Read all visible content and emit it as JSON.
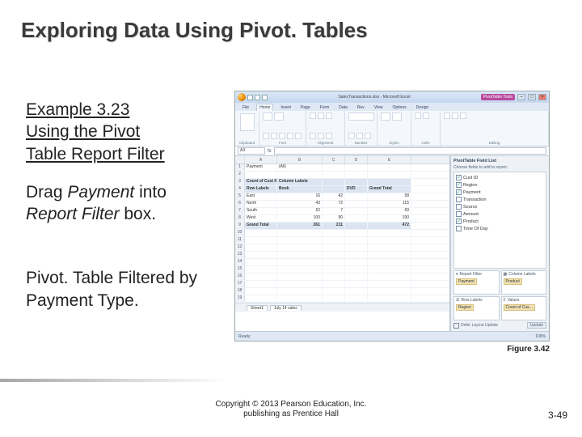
{
  "title": "Exploring Data Using Pivot. Tables",
  "example": {
    "number": "Example 3.23",
    "subtitle_l1": "Using the Pivot",
    "subtitle_l2": "Table Report Filter"
  },
  "instruction": {
    "prefix": "Drag ",
    "field": "Payment",
    "mid": " into ",
    "box": "Report Filter",
    "suffix": " box."
  },
  "filtered_text": "Pivot. Table Filtered by Payment Type.",
  "figure": {
    "window_title": "SalesTransactions.xlsx - Microsoft Excel",
    "contextual_tab": "PivotTable Tools",
    "tabs": [
      "File",
      "Home",
      "Insert",
      "Page",
      "Form",
      "Data",
      "Rev",
      "View",
      "Options",
      "Design"
    ],
    "ribbon_groups": [
      "Clipboard",
      "Font",
      "Alignment",
      "Number",
      "Styles",
      "Cells",
      "Editing"
    ],
    "namebox": "A3",
    "columns": [
      "A",
      "B",
      "C",
      "D",
      "E"
    ],
    "pivot": {
      "filter_field": "Payment",
      "filter_value": "(All)",
      "count_label": "Count of Cust ID",
      "collabel": "Column Labels",
      "rowlabel": "Row Labels",
      "col_categories": [
        "Book",
        "DVD",
        "Grand Total"
      ],
      "rows": [
        {
          "label": "East",
          "v": [
            16,
            42,
            58
          ]
        },
        {
          "label": "North",
          "v": [
            43,
            72,
            115
          ]
        },
        {
          "label": "South",
          "v": [
            62,
            7,
            69
          ]
        },
        {
          "label": "West",
          "v": [
            100,
            90,
            190
          ]
        }
      ],
      "grand_total": {
        "label": "Grand Total",
        "v": [
          261,
          211,
          472
        ]
      }
    },
    "fieldlist": {
      "title": "PivotTable Field List",
      "sub": "Choose fields to add to report:",
      "fields": [
        {
          "name": "Cust ID",
          "checked": true
        },
        {
          "name": "Region",
          "checked": true
        },
        {
          "name": "Payment",
          "checked": true
        },
        {
          "name": "Transaction",
          "checked": false
        },
        {
          "name": "Source",
          "checked": false
        },
        {
          "name": "Amount",
          "checked": false
        },
        {
          "name": "Product",
          "checked": true
        },
        {
          "name": "Time Of Day",
          "checked": false
        }
      ],
      "areas": {
        "report_filter": {
          "label": "Report Filter",
          "item": "Payment"
        },
        "column_labels": {
          "label": "Column Labels",
          "item": "Product"
        },
        "row_labels": {
          "label": "Row Labels",
          "item": "Region"
        },
        "values": {
          "label": "Values",
          "item": "Count of Cus..."
        }
      },
      "defer": "Defer Layout Update",
      "update": "Update"
    },
    "sheets": [
      "Sheet1",
      "July 14 sales"
    ],
    "status_ready": "Ready",
    "zoom": "100%"
  },
  "caption": "Figure 3.42",
  "copyright_l1": "Copyright © 2013 Pearson Education, Inc.",
  "copyright_l2": "publishing as Prentice Hall",
  "page": "3-49"
}
